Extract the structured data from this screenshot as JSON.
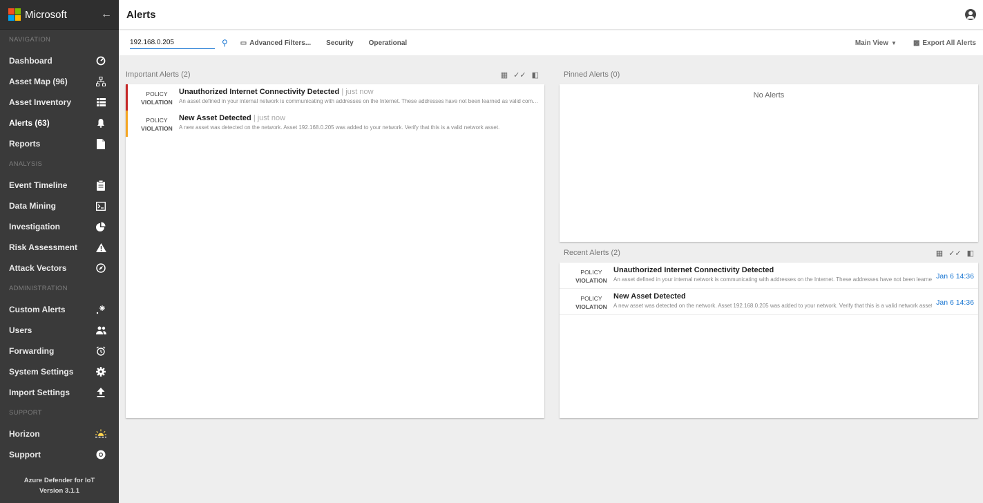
{
  "brand": {
    "name": "Microsoft"
  },
  "sidebar": {
    "sections": [
      {
        "title": "NAVIGATION",
        "items": [
          {
            "label": "Dashboard",
            "icon": "gauge-icon"
          },
          {
            "label": "Asset Map (96)",
            "icon": "sitemap-icon"
          },
          {
            "label": "Asset Inventory",
            "icon": "list-icon"
          },
          {
            "label": "Alerts (63)",
            "icon": "bell-icon",
            "active": true
          },
          {
            "label": "Reports",
            "icon": "document-icon"
          }
        ]
      },
      {
        "title": "ANALYSIS",
        "items": [
          {
            "label": "Event Timeline",
            "icon": "clipboard-icon"
          },
          {
            "label": "Data Mining",
            "icon": "terminal-icon"
          },
          {
            "label": "Investigation",
            "icon": "pie-chart-icon"
          },
          {
            "label": "Risk Assessment",
            "icon": "warning-icon"
          },
          {
            "label": "Attack Vectors",
            "icon": "compass-icon"
          }
        ]
      },
      {
        "title": "ADMINISTRATION",
        "items": [
          {
            "label": "Custom Alerts",
            "icon": "sparkle-icon"
          },
          {
            "label": "Users",
            "icon": "users-icon"
          },
          {
            "label": "Forwarding",
            "icon": "alarm-clock-icon"
          },
          {
            "label": "System Settings",
            "icon": "gear-icon"
          },
          {
            "label": "Import Settings",
            "icon": "upload-icon"
          }
        ]
      },
      {
        "title": "SUPPORT",
        "items": [
          {
            "label": "Horizon",
            "icon": "sunrise-icon"
          },
          {
            "label": "Support",
            "icon": "lifebuoy-icon"
          }
        ]
      }
    ],
    "footer_line1": "Azure Defender for IoT",
    "footer_line2": "Version 3.1.1"
  },
  "header": {
    "title": "Alerts"
  },
  "toolbar": {
    "search_value": "192.168.0.205",
    "advanced_filters": "Advanced Filters...",
    "security": "Security",
    "operational": "Operational",
    "main_view": "Main View",
    "export": "Export All Alerts"
  },
  "important": {
    "title": "Important Alerts (2)",
    "alerts": [
      {
        "type1": "POLICY",
        "type2": "VIOLATION",
        "title": "Unauthorized Internet Connectivity Detected",
        "time": "| just now",
        "desc": "An asset defined in your internal network is communicating with addresses on the Internet. These addresses have not been learned as valid communication addresses.",
        "severity": "#c62828"
      },
      {
        "type1": "POLICY",
        "type2": "VIOLATION",
        "title": "New Asset Detected",
        "time": "| just now",
        "desc": "A new asset was detected on the network. Asset 192.168.0.205 was added to your network. Verify that this is a valid network asset.",
        "severity": "#f5a623"
      }
    ]
  },
  "pinned": {
    "title": "Pinned Alerts (0)",
    "empty": "No Alerts"
  },
  "recent": {
    "title": "Recent Alerts (2)",
    "alerts": [
      {
        "type1": "POLICY",
        "type2": "VIOLATION",
        "title": "Unauthorized Internet Connectivity Detected",
        "desc": "An asset defined in your internal network is communicating with addresses on the Internet. These addresses have not been learned",
        "date": "Jan 6 14:36"
      },
      {
        "type1": "POLICY",
        "type2": "VIOLATION",
        "title": "New Asset Detected",
        "desc": "A new asset was detected on the network. Asset 192.168.0.205 was added to your network. Verify that this is a valid network asset.",
        "date": "Jan 6 14:36"
      }
    ]
  }
}
